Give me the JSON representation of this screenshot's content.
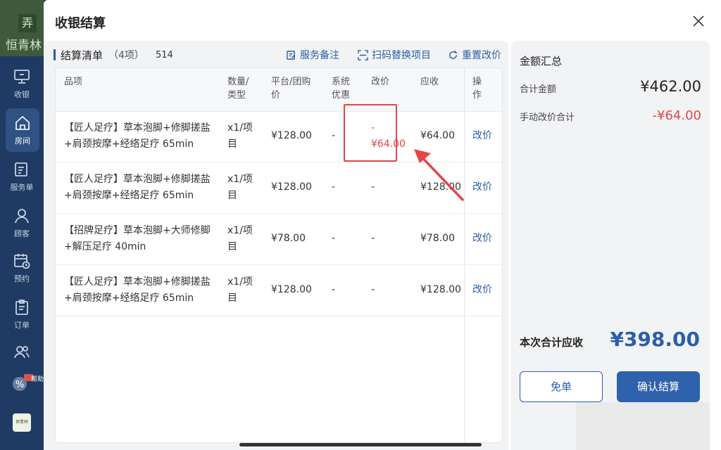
{
  "nav": {
    "brand_logo": "弄",
    "brand_text": "恒青林",
    "items": [
      {
        "label": "收银",
        "icon": "monitor-icon"
      },
      {
        "label": "房间",
        "icon": "house-icon"
      },
      {
        "label": "服务单",
        "icon": "service-list-icon"
      },
      {
        "label": "顾客",
        "icon": "user-icon"
      },
      {
        "label": "预约",
        "icon": "calendar-clock-icon"
      },
      {
        "label": "订单",
        "icon": "clipboard-icon"
      }
    ],
    "help_badge": "帮助",
    "footer_logo": "恒青林"
  },
  "modal": {
    "title": "收银结算"
  },
  "list": {
    "title": "结算清单",
    "count": "（4项）",
    "code": "514",
    "actions": {
      "note": "服务备注",
      "scan": "扫码替换项目",
      "reset": "重置改价"
    },
    "headers": {
      "item": "品项",
      "qty": "数量/类型",
      "price": "平台/团购价",
      "discount": "系统优惠",
      "adjust": "改价",
      "receivable": "应收",
      "op": "操作"
    },
    "rows": [
      {
        "name": "【匠人足疗】草本泡脚+修脚搓盐+肩颈按摩+经络足疗 65min",
        "qty": "x1/项目",
        "price": "¥128.00",
        "discount": "-",
        "adjust_sign": "-",
        "adjust": "¥64.00",
        "receivable": "¥64.00",
        "op": "改价"
      },
      {
        "name": "【匠人足疗】草本泡脚+修脚搓盐+肩颈按摩+经络足疗 65min",
        "qty": "x1/项目",
        "price": "¥128.00",
        "discount": "-",
        "adjust_sign": "",
        "adjust": "-",
        "receivable": "¥128.00",
        "op": "改价"
      },
      {
        "name": "【招牌足疗】草本泡脚+大师修脚+解压足疗 40min",
        "qty": "x1/项目",
        "price": "¥78.00",
        "discount": "-",
        "adjust_sign": "",
        "adjust": "-",
        "receivable": "¥78.00",
        "op": "改价"
      },
      {
        "name": "【匠人足疗】草本泡脚+修脚搓盐+肩颈按摩+经络足疗 65min",
        "qty": "x1/项目",
        "price": "¥128.00",
        "discount": "-",
        "adjust_sign": "",
        "adjust": "-",
        "receivable": "¥128.00",
        "op": "改价"
      }
    ]
  },
  "summary": {
    "title": "金额汇总",
    "total_label": "合计金额",
    "total_value": "¥462.00",
    "manual_label": "手动改价合计",
    "manual_value": "-¥64.00",
    "due_label": "本次合计应收",
    "due_value": "¥398.00",
    "free_button": "免单",
    "confirm_button": "确认结算"
  },
  "colors": {
    "accent": "#2a5fa8",
    "danger": "#e64545",
    "nav_bg": "#1f3a63"
  }
}
